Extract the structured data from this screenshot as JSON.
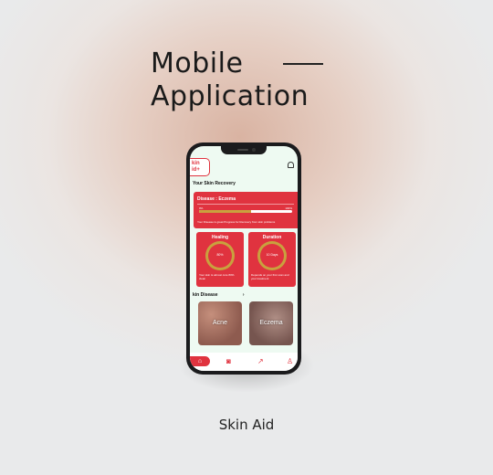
{
  "headline": {
    "line1": "Mobile",
    "line2": "Application"
  },
  "caption": "Skin Aid",
  "app": {
    "logo_text_1": "kin",
    "logo_text_2": "id+",
    "recovery_title": "Your Skin Recovery",
    "disease_label": "Disease : Eczema",
    "progress_start": "0%",
    "progress_end": "100%",
    "progress_value": 0.56,
    "disease_note": "Your Disease is great Progress for Recovery from skin problems",
    "healing": {
      "title": "Healing",
      "value": "80%",
      "note": "Your skin is almost cure 80% clean"
    },
    "duration": {
      "title": "Duration",
      "value": "10 Days",
      "note": "Depends on your first scan and your treatment"
    },
    "skin_disease_title": "kin Disease",
    "skin_disease_arrow": "›",
    "tiles": [
      {
        "label": "Acne"
      },
      {
        "label": "Eczema"
      }
    ],
    "nav": {
      "home_icon": "home-icon",
      "camera_icon": "camera-icon",
      "trend_icon": "trend-icon",
      "profile_icon": "profile-icon"
    }
  },
  "colors": {
    "accent": "#e0333f",
    "gold": "#c9a13e",
    "screen_bg": "#eefaf2"
  }
}
